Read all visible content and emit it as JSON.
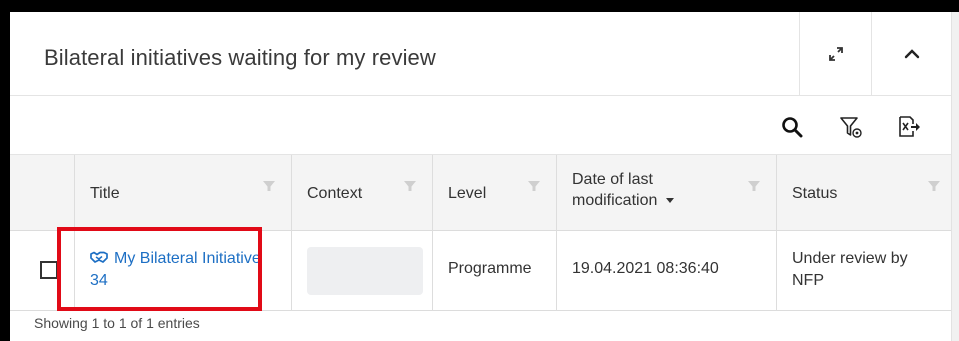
{
  "widget": {
    "title": "Bilateral initiatives waiting for my review",
    "expand_icon": "expand-arrows-icon",
    "collapse_icon": "chevron-up-icon"
  },
  "toolbar": {
    "search_icon": "search-icon",
    "filter_icon": "filter-settings-icon",
    "export_icon": "export-excel-icon"
  },
  "table": {
    "columns": [
      {
        "key": "title",
        "label": "Title"
      },
      {
        "key": "context",
        "label": "Context"
      },
      {
        "key": "level",
        "label": "Level"
      },
      {
        "key": "date",
        "label": "Date of last modification",
        "sort": "descending"
      },
      {
        "key": "status",
        "label": "Status"
      }
    ],
    "rows": [
      {
        "title": "My Bilateral Initiative 34",
        "title_icon": "handshake-icon",
        "context": "",
        "level": "Programme",
        "date": "19.04.2021 08:36:40",
        "status": "Under review by NFP"
      }
    ],
    "footer": "Showing 1 to 1 of 1 entries"
  },
  "colors": {
    "link": "#1d6fc4",
    "highlight": "#e10a17",
    "header_bg": "#f4f4f4"
  }
}
